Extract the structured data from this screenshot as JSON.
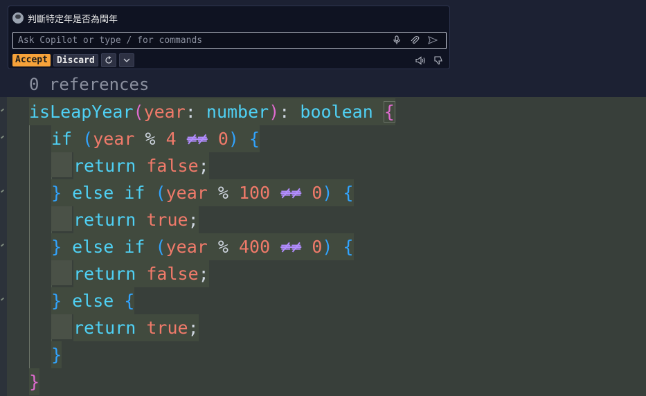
{
  "copilot": {
    "title": "判斷特定年是否為閏年",
    "input_placeholder": "Ask Copilot or type / for commands",
    "input_value": "",
    "accept_label": "Accept",
    "discard_label": "Discard",
    "icons": [
      "copilot-avatar-icon",
      "mic-icon",
      "attach-icon",
      "send-icon",
      "refresh-icon",
      "chevron-down-icon",
      "speaker-icon",
      "thumbs-down-icon"
    ]
  },
  "editor": {
    "references": "0 references",
    "lines": [
      {
        "text": "isLeapYear(year: number): boolean {"
      },
      {
        "text": "if (year % 4 !== 0) {"
      },
      {
        "text": "return false;"
      },
      {
        "text": "} else if (year % 100 !== 0) {"
      },
      {
        "text": "return true;"
      },
      {
        "text": "} else if (year % 400 !== 0) {"
      },
      {
        "text": "return false;"
      },
      {
        "text": "} else {"
      },
      {
        "text": "return true;"
      },
      {
        "text": "}"
      },
      {
        "text": "}"
      }
    ]
  },
  "colors": {
    "background": "#363d3a",
    "accept": "#f6a23a",
    "function": "#4fd1f5",
    "paren": "#31a4ff",
    "number": "#f07a6a",
    "brace_pink": "#e06bd0",
    "not_equal": "#b28cff"
  }
}
